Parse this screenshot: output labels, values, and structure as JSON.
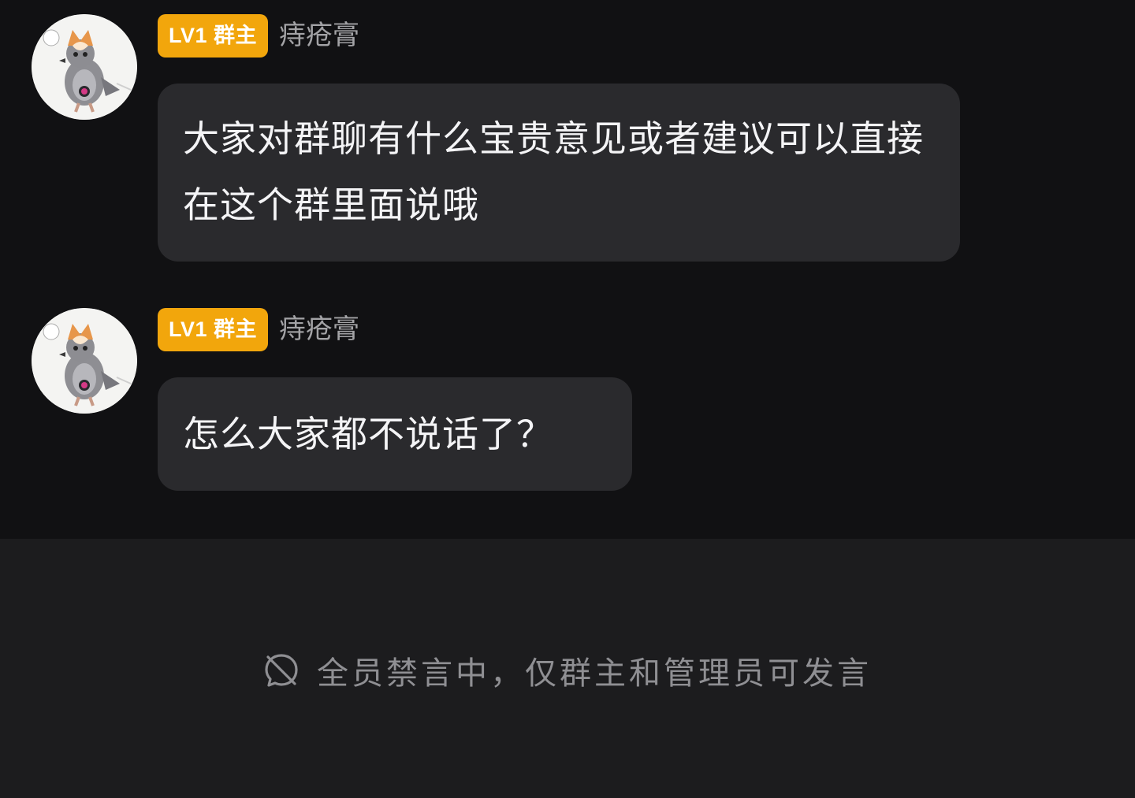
{
  "messages": [
    {
      "badge": "LV1 群主",
      "sender": "痔疮膏",
      "text": "大家对群聊有什么宝贵意见或者建议可以直接在这个群里面说哦",
      "avatar_icon": "pigeon-shiba-avatar-icon"
    },
    {
      "badge": "LV1 群主",
      "sender": "痔疮膏",
      "text": "怎么大家都不说话了？",
      "avatar_icon": "pigeon-shiba-avatar-icon"
    }
  ],
  "footer": {
    "mute_icon": "mute-icon",
    "notice": "全员禁言中，仅群主和管理员可发言"
  },
  "colors": {
    "background": "#111113",
    "bubble": "#2a2a2d",
    "badge": "#f2a60c",
    "footer": "#1c1c1e"
  }
}
